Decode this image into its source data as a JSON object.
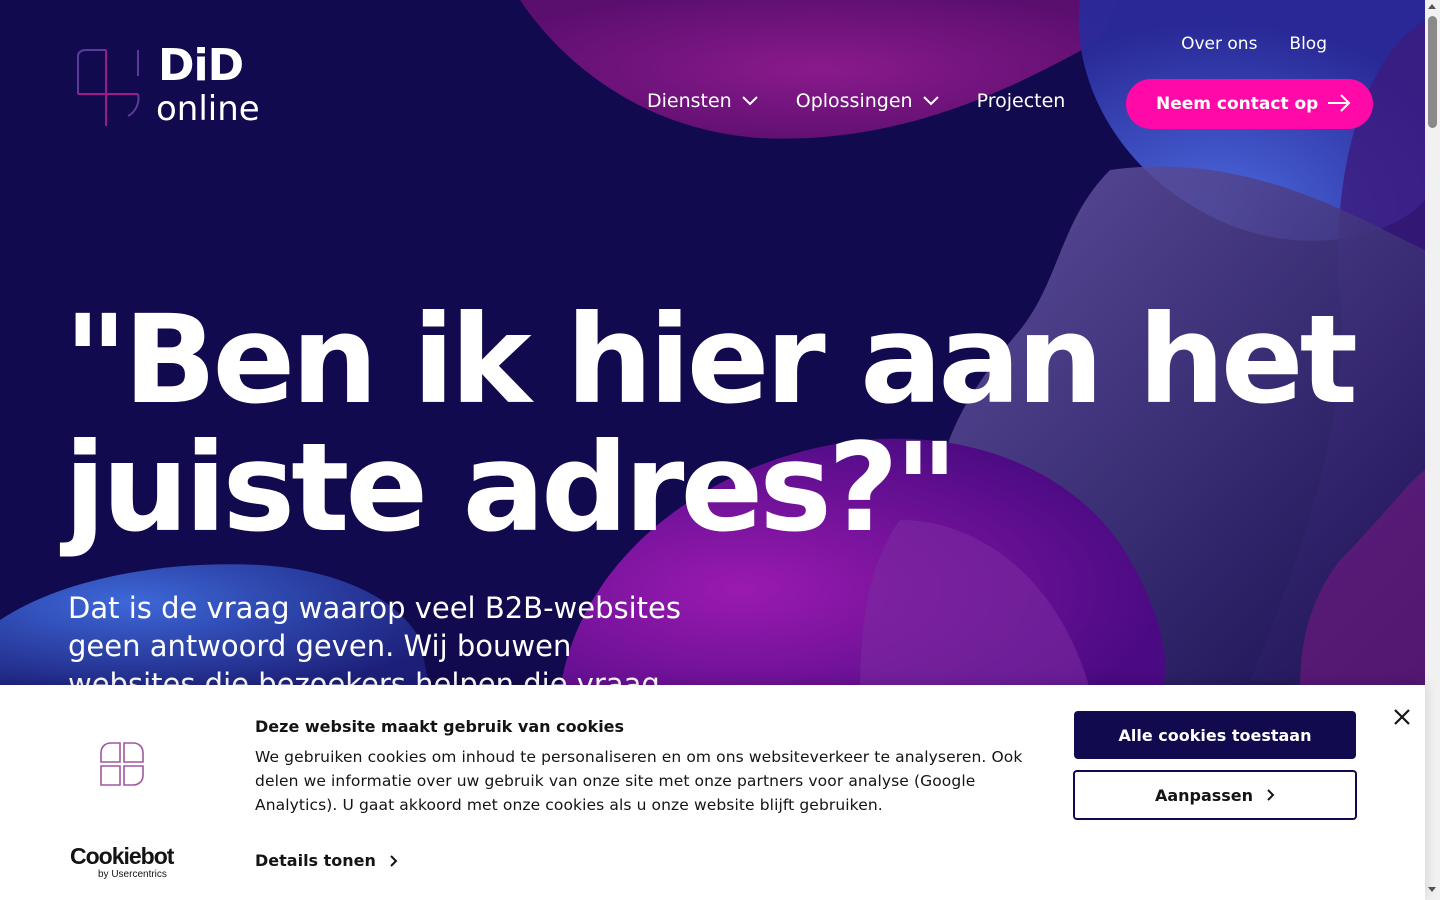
{
  "header": {
    "logo_top": "DiD",
    "logo_bottom": "online",
    "top_links": [
      "Over ons",
      "Blog"
    ],
    "main_nav": [
      {
        "label": "Diensten",
        "has_dropdown": true
      },
      {
        "label": "Oplossingen",
        "has_dropdown": true
      },
      {
        "label": "Projecten",
        "has_dropdown": false
      }
    ],
    "cta_label": "Neem contact op",
    "cta_icon": "arrow-right-icon"
  },
  "hero": {
    "title_line1": "\"Ben ik hier aan het",
    "title_line2": "juiste adres?\"",
    "subtitle": "Dat is de vraag waarop veel B2B-websites geen antwoord geven. Wij bouwen websites die bezoekers helpen die vraag"
  },
  "cookie_banner": {
    "brand": "Cookiebot",
    "brand_sub": "by Usercentrics",
    "title": "Deze website maakt gebruik van cookies",
    "text": "We gebruiken cookies om inhoud te personaliseren en om ons websiteverkeer te analyseren. Ook delen we informatie over uw gebruik van onze site met onze partners voor analyse (Google Analytics). U gaat akkoord met onze cookies als u onze website blijft gebruiken.",
    "details_label": "Details tonen",
    "allow_label": "Alle cookies toestaan",
    "customize_label": "Aanpassen",
    "close_icon": "close-icon"
  },
  "colors": {
    "background": "#120a4e",
    "accent": "#ff0aa8",
    "button_dark": "#120a4e"
  }
}
